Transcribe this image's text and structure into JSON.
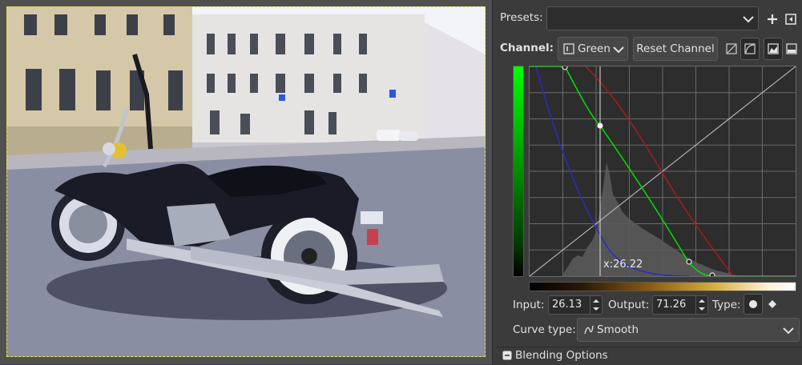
{
  "presets": {
    "label": "Presets:",
    "value": ""
  },
  "channel": {
    "label": "Channel:",
    "value": "Green",
    "reset_label": "Reset Channel"
  },
  "curve": {
    "readout": "x:26.22",
    "input_label": "Input:",
    "input_value": "26.13",
    "output_label": "Output:",
    "output_value": "71.26",
    "type_label": "Type:"
  },
  "curve_type": {
    "label": "Curve type:",
    "value": "Smooth"
  },
  "blending": {
    "label": "Blending Options"
  },
  "colors": {
    "accent_green": "#00e000",
    "red_curve": "#b01818",
    "blue_curve": "#2a2ac8",
    "selection": "#e3e34a"
  },
  "icons": [
    "add-preset-icon",
    "preset-menu-icon",
    "channel-icon",
    "linear-histogram-icon",
    "log-histogram-icon",
    "smooth-curve-icon",
    "freehand-icon",
    "smooth-curve-type-icon"
  ]
}
